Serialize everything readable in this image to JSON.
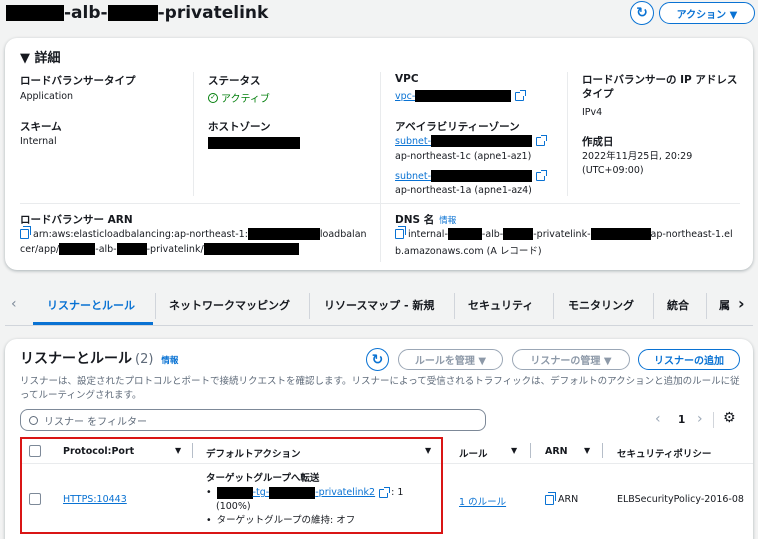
{
  "header": {
    "title_suffix_1": "-alb-",
    "title_suffix_2": "-privatelink",
    "actions_label": "アクション ▼"
  },
  "details": {
    "heading": "▼ 詳細",
    "lb_type_label": "ロードバランサータイプ",
    "lb_type_value": "Application",
    "status_label": "ステータス",
    "status_value": "アクティブ",
    "vpc_label": "VPC",
    "vpc_prefix": "vpc-",
    "ip_type_label": "ロードバランサーの IP アドレスタイプ",
    "ip_type_value": "IPv4",
    "scheme_label": "スキーム",
    "scheme_value": "Internal",
    "hosted_zone_label": "ホストゾーン",
    "az_label": "アベイラビリティーゾーン",
    "subnet_prefix": "subnet-",
    "az1_value": "ap-northeast-1c (apne1-az1)",
    "az2_value": "ap-northeast-1a (apne1-az4)",
    "created_label": "作成日",
    "created_value": "2022年11月25日, 20:29 (UTC+09:00)",
    "arn_label": "ロードバランサー ARN",
    "arn_part1": "arn:aws:elasticloadbalancing:ap-northeast-1:",
    "arn_part2": "loadbalan",
    "arn_part3": "cer/app/",
    "arn_part4": "-alb-",
    "arn_part5": "-privatelink/",
    "dns_label": "DNS 名",
    "dns_info": "情報",
    "dns_part1": "internal-",
    "dns_part2": "-alb-",
    "dns_part3": "-privatelink-",
    "dns_part4": "ap-northeast-1.el",
    "dns_part5": "b.amazonaws.com (A レコード)"
  },
  "tabs": [
    "リスナーとルール",
    "ネットワークマッピング",
    "リソースマップ - 新規",
    "セキュリティ",
    "モニタリング",
    "統合",
    "属"
  ],
  "listeners": {
    "title": "リスナーとルール",
    "count": "(2)",
    "info": "情報",
    "manage_rules": "ルールを管理 ▼",
    "manage_listeners": "リスナーの管理 ▼",
    "add_listener": "リスナーの追加",
    "description": "リスナーは、設定されたプロトコルとポートで接続リクエストを確認します。リスナーによって受信されるトラフィックは、デフォルトのアクションと追加のルールに従ってルーティングされます。",
    "filter_placeholder": "リスナー をフィルター",
    "page": "1",
    "columns": [
      "Protocol:Port",
      "デフォルトアクション",
      "ルール",
      "ARN",
      "セキュリティポリシー"
    ],
    "row": {
      "protocol_port": "HTTPS:10443",
      "action_title": "ターゲットグループへ転送",
      "tg_part1": "-tg-",
      "tg_part2": "-privatelink2",
      "tg_weight_1": ": 1",
      "tg_weight_2": "(100%)",
      "stickiness": "ターゲットグループの維持: オフ",
      "rules": "1 のルール",
      "arn": "ARN",
      "policy": "ELBSecurityPolicy-2016-08"
    }
  },
  "colors": {
    "accent": "#0972d3",
    "success": "#037f0c",
    "highlight_border": "#d91515"
  }
}
